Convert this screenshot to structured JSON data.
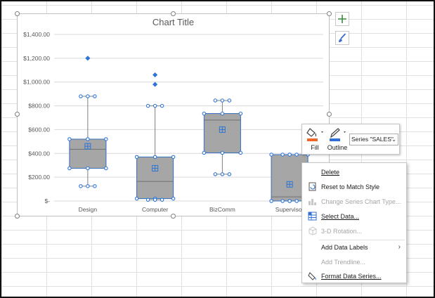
{
  "chart": {
    "title": "Chart Title",
    "y_ticks": [
      "$1,400.00",
      "$1,200.00",
      "$1,000.00",
      "$800.00",
      "$600.00",
      "$400.00",
      "$200.00",
      "$-"
    ],
    "categories": [
      "Design",
      "Computer",
      "BizComm",
      "Supervisor"
    ]
  },
  "chart_data": {
    "type": "box",
    "title": "Chart Title",
    "categories": [
      "Design",
      "Computer",
      "BizComm",
      "Supervisor"
    ],
    "ylim": [
      0,
      1400
    ],
    "grid": true,
    "box_color": "#a6a6a6",
    "boxes": [
      {
        "category": "Design",
        "min": 125,
        "q1": 275,
        "median": 435,
        "q3": 520,
        "max": 880,
        "mean": 460,
        "outliers": [
          1200
        ]
      },
      {
        "category": "Computer",
        "min": 10,
        "q1": 20,
        "median": 165,
        "q3": 370,
        "max": 800,
        "mean": 275,
        "outliers": [
          980,
          1060
        ]
      },
      {
        "category": "BizComm",
        "min": 225,
        "q1": 405,
        "median": 680,
        "q3": 735,
        "max": 845,
        "mean": 600,
        "outliers": []
      },
      {
        "category": "Supervisor",
        "min": 0,
        "q1": 0,
        "median": 35,
        "q3": 390,
        "max": 390,
        "mean": 140,
        "outliers": []
      }
    ]
  },
  "mini_toolbar": {
    "fill_label": "Fill",
    "outline_label": "Outline",
    "series_value": "Series \"SALES\"",
    "fill_color": "#f0662a",
    "outline_color": "#2f6fd6"
  },
  "context_menu": {
    "delete": "Delete",
    "reset": "Reset to Match Style",
    "change_type": "Change Series Chart Type...",
    "select_data": "Select Data...",
    "rotation": "3-D Rotation...",
    "add_labels": "Add Data Labels",
    "add_trendline": "Add Trendline...",
    "format_series": "Format Data Series..."
  }
}
